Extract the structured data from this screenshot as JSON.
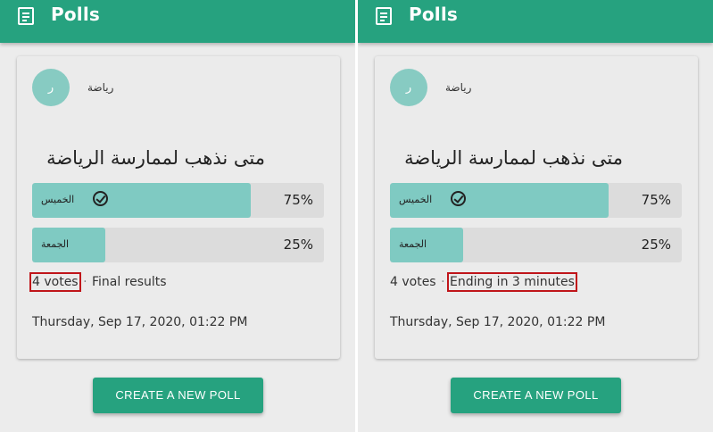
{
  "panels": [
    {
      "appbar": {
        "title": "Polls",
        "icon": "document-list-icon"
      },
      "poll": {
        "author_initial": "ر",
        "author_name": "رياضة",
        "question": "متى نذهب لممارسة الرياضة",
        "options": [
          {
            "label": "الخميس",
            "percent_text": "75%",
            "percent": 75,
            "selected": true
          },
          {
            "label": "الجمعة",
            "percent_text": "25%",
            "percent": 25,
            "selected": false
          }
        ],
        "votes": "4 votes",
        "separator": "·",
        "status": "Final results",
        "timestamp": "Thursday, Sep 17, 2020, 01:22 PM"
      },
      "create_button": "CREATE A NEW POLL"
    },
    {
      "appbar": {
        "title": "Polls",
        "icon": "document-list-icon"
      },
      "poll": {
        "author_initial": "ر",
        "author_name": "رياضة",
        "question": "متى نذهب لممارسة الرياضة",
        "options": [
          {
            "label": "الخميس",
            "percent_text": "75%",
            "percent": 75,
            "selected": true
          },
          {
            "label": "الجمعة",
            "percent_text": "25%",
            "percent": 25,
            "selected": false
          }
        ],
        "votes": "4 votes",
        "separator": "·",
        "status": "Ending in 3 minutes",
        "timestamp": "Thursday, Sep 17, 2020, 01:22 PM"
      },
      "create_button": "CREATE A NEW POLL"
    }
  ],
  "colors": {
    "primary": "#26a27f",
    "option_fill": "#7fcac2",
    "option_track": "#dcdcdc",
    "highlight_box": "#c0151a",
    "avatar": "#87cbc2"
  }
}
